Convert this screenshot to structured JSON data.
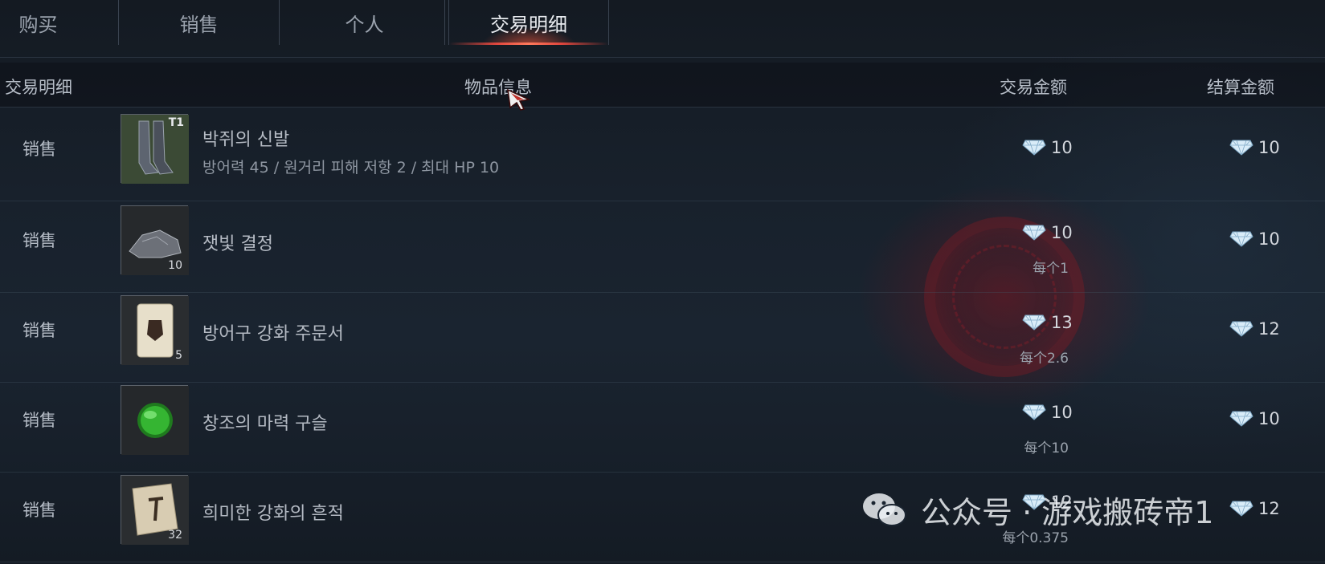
{
  "tabs": [
    {
      "label": "购买",
      "active": false
    },
    {
      "label": "销售",
      "active": false
    },
    {
      "label": "个人",
      "active": false
    },
    {
      "label": "交易明细",
      "active": true
    }
  ],
  "header": {
    "col_type": "交易明细",
    "col_item": "物品信息",
    "col_trade": "交易金额",
    "col_settle": "结算金额"
  },
  "rows": [
    {
      "type": "销售",
      "name": "박쥐의 신발",
      "stats": "방어력 45 / 원거리 피해 저항 2 / 최대 HP 10",
      "tier": "T1",
      "qty": "",
      "trade": "10",
      "unit": "",
      "settle": "10",
      "icon": "boots-icon"
    },
    {
      "type": "销售",
      "name": "잿빛 결정",
      "stats": "",
      "tier": "",
      "qty": "10",
      "trade": "10",
      "unit": "每个1",
      "settle": "10",
      "icon": "ore-icon"
    },
    {
      "type": "销售",
      "name": "방어구 강화 주문서",
      "stats": "",
      "tier": "",
      "qty": "5",
      "trade": "13",
      "unit": "每个2.6",
      "settle": "12",
      "icon": "scroll-icon"
    },
    {
      "type": "销售",
      "name": "창조의 마력 구슬",
      "stats": "",
      "tier": "",
      "qty": "",
      "trade": "10",
      "unit": "每个10",
      "settle": "10",
      "icon": "green-orb-icon"
    },
    {
      "type": "销售",
      "name": "희미한 강화의 흔적",
      "stats": "",
      "tier": "",
      "qty": "32",
      "trade": "12",
      "unit": "每个0.375",
      "settle": "12",
      "icon": "parchment-icon"
    }
  ],
  "currency_icon": "diamond-icon",
  "watermark": "公众号 · 游戏搬砖帝1",
  "colors": {
    "accent": "#e0473e",
    "bg": "#18212c",
    "diamond": "#cfe6f5"
  }
}
